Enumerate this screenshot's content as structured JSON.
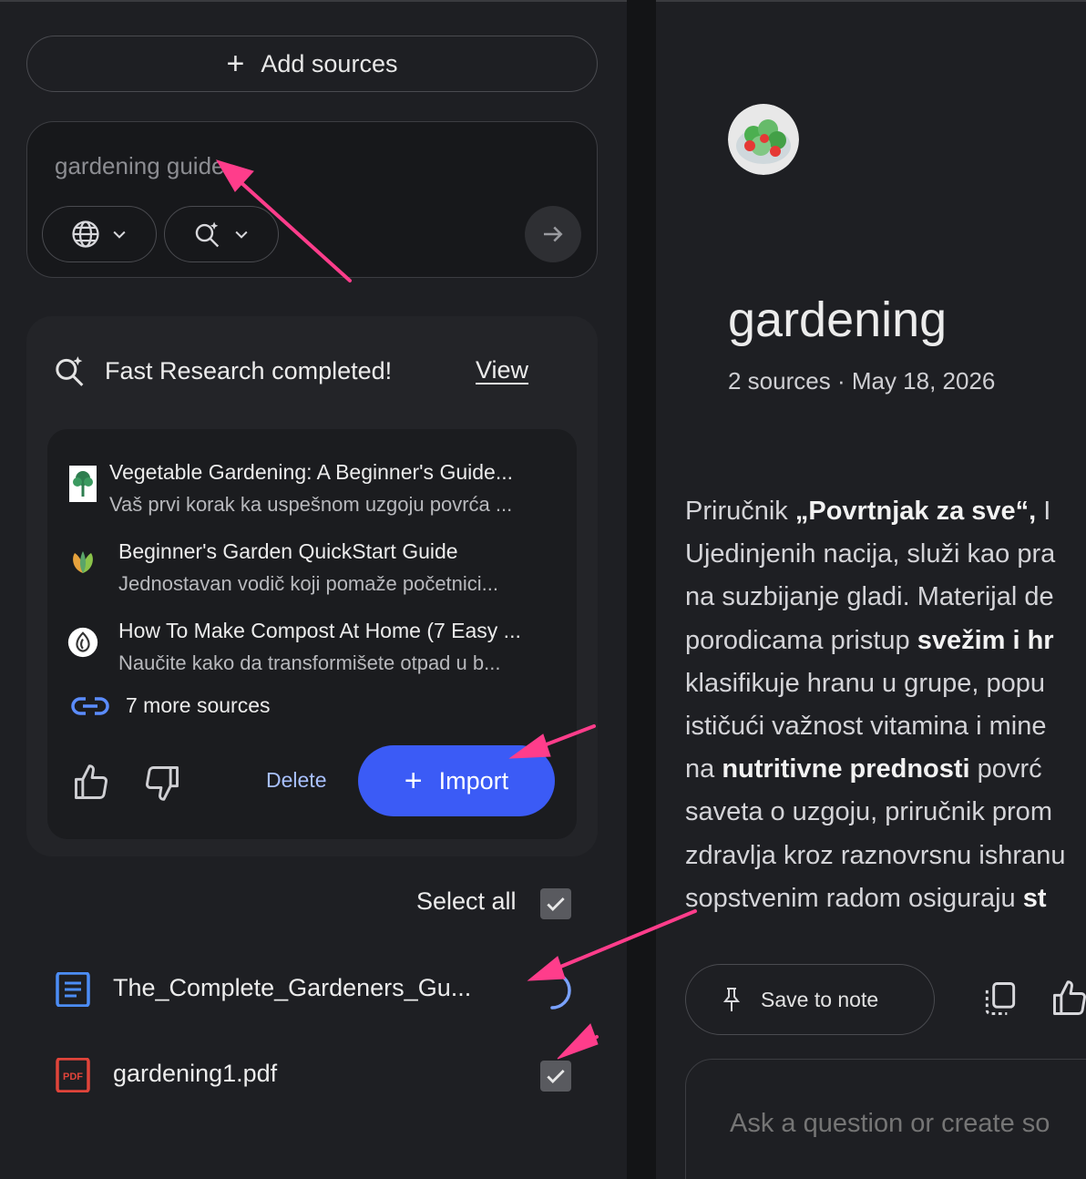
{
  "sources_panel": {
    "add_sources_label": "Add sources",
    "search": {
      "value": "gardening guide"
    },
    "research": {
      "status": "Fast Research completed!",
      "view_label": "View",
      "results": [
        {
          "title": "Vegetable Gardening: A Beginner's Guide...",
          "description": "Vaš prvi korak ka uspešnom uzgoju povrća ..."
        },
        {
          "title": "Beginner's Garden QuickStart Guide",
          "description": "Jednostavan vodič koji pomaže početnici..."
        },
        {
          "title": "How To Make Compost At Home (7 Easy ...",
          "description": "Naučite kako da transformišete otpad u b..."
        }
      ],
      "more_sources_label": "7 more sources",
      "delete_label": "Delete",
      "import_label": "Import"
    },
    "select_all_label": "Select all",
    "sources": [
      {
        "name": "The_Complete_Gardeners_Gu...",
        "type": "doc",
        "state": "loading"
      },
      {
        "name": "gardening1.pdf",
        "type": "pdf",
        "state": "checked"
      }
    ]
  },
  "notebook": {
    "title": "gardening",
    "meta": "2 sources · May 18, 2026",
    "save_to_note_label": "Save to note",
    "ask_placeholder": "Ask a question or create so"
  },
  "colors": {
    "accent_blue": "#3b5bf6",
    "annotation_pink": "#ff3d8b",
    "background": "#1e1f23"
  }
}
